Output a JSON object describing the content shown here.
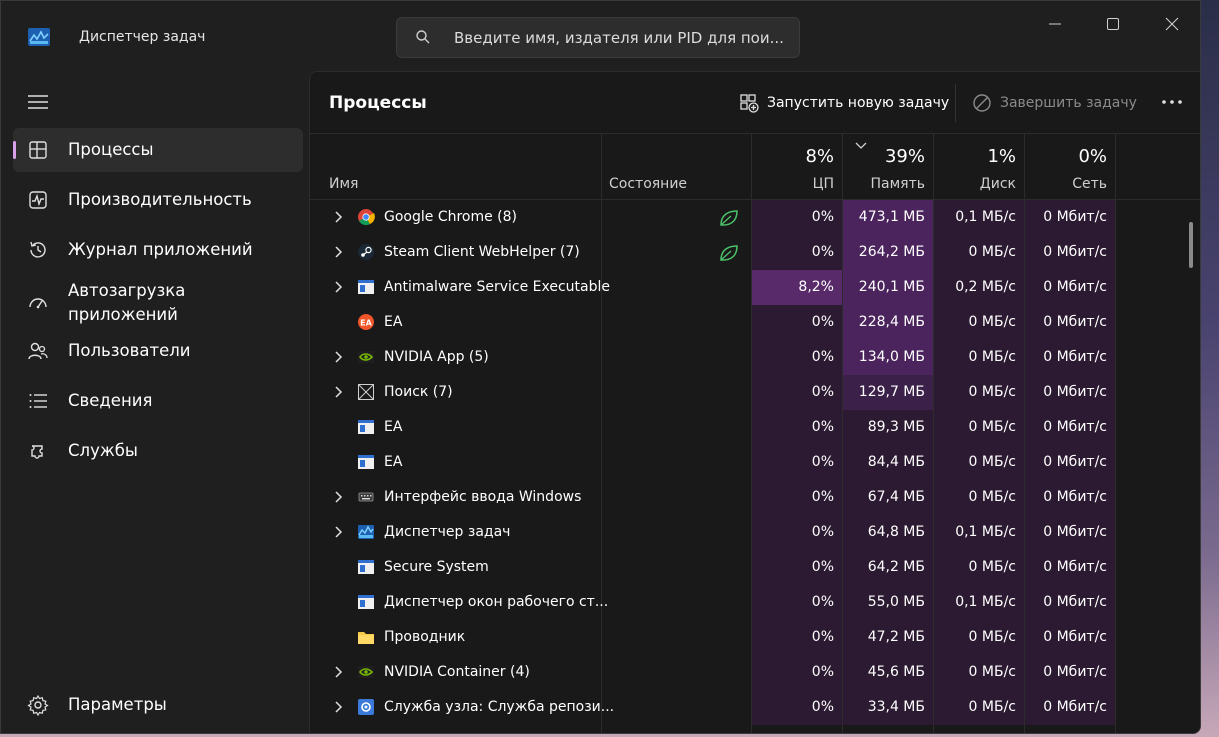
{
  "window": {
    "title": "Диспетчер задач",
    "search_placeholder": "Введите имя, издателя или PID для пои..."
  },
  "sidebar": {
    "items": [
      {
        "label": "Процессы",
        "icon": "processes-icon",
        "active": true
      },
      {
        "label": "Производительность",
        "icon": "performance-icon"
      },
      {
        "label": "Журнал приложений",
        "icon": "app-history-icon"
      },
      {
        "label": "Автозагрузка\nприложений",
        "icon": "startup-apps-icon"
      },
      {
        "label": "Пользователи",
        "icon": "users-icon"
      },
      {
        "label": "Сведения",
        "icon": "details-icon"
      },
      {
        "label": "Службы",
        "icon": "services-icon"
      }
    ],
    "settings_label": "Параметры"
  },
  "toolbar": {
    "page_title": "Процессы",
    "run_task_label": "Запустить новую задачу",
    "end_task_label": "Завершить задачу"
  },
  "columns": {
    "name": "Имя",
    "status": "Состояние",
    "cpu": {
      "pct": "8%",
      "label": "ЦП"
    },
    "memory": {
      "pct": "39%",
      "label": "Память"
    },
    "disk": {
      "pct": "1%",
      "label": "Диск"
    },
    "network": {
      "pct": "0%",
      "label": "Сеть"
    }
  },
  "colors": {
    "heat_1": "#2b1a31",
    "heat_2": "#3b2049",
    "heat_3": "#4c245d",
    "heat_4": "#582a6a",
    "accent": "#d8a1ea"
  },
  "processes": [
    {
      "name": "Google Chrome (8)",
      "icon": "chrome-icon",
      "expandable": true,
      "eco": true,
      "cpu": "0%",
      "memory": "473,1 МБ",
      "disk": "0,1 МБ/с",
      "network": "0 Мбит/с"
    },
    {
      "name": "Steam Client WebHelper (7)",
      "icon": "steam-icon",
      "expandable": true,
      "eco": true,
      "cpu": "0%",
      "memory": "264,2 МБ",
      "disk": "0 МБ/с",
      "network": "0 Мбит/с"
    },
    {
      "name": "Antimalware Service Executable",
      "icon": "window-app-icon",
      "expandable": true,
      "eco": false,
      "cpu": "8,2%",
      "memory": "240,1 МБ",
      "disk": "0,2 МБ/с",
      "network": "0 Мбит/с"
    },
    {
      "name": "EA",
      "icon": "ea-icon",
      "expandable": false,
      "eco": false,
      "cpu": "0%",
      "memory": "228,4 МБ",
      "disk": "0 МБ/с",
      "network": "0 Мбит/с"
    },
    {
      "name": "NVIDIA App (5)",
      "icon": "nvidia-icon",
      "expandable": true,
      "eco": false,
      "cpu": "0%",
      "memory": "134,0 МБ",
      "disk": "0 МБ/с",
      "network": "0 Мбит/с"
    },
    {
      "name": "Поиск (7)",
      "icon": "search-app-icon",
      "expandable": true,
      "eco": false,
      "cpu": "0%",
      "memory": "129,7 МБ",
      "disk": "0 МБ/с",
      "network": "0 Мбит/с"
    },
    {
      "name": "EA",
      "icon": "window-app-icon",
      "expandable": false,
      "eco": false,
      "cpu": "0%",
      "memory": "89,3 МБ",
      "disk": "0 МБ/с",
      "network": "0 Мбит/с"
    },
    {
      "name": "EA",
      "icon": "window-app-icon",
      "expandable": false,
      "eco": false,
      "cpu": "0%",
      "memory": "84,4 МБ",
      "disk": "0 МБ/с",
      "network": "0 Мбит/с"
    },
    {
      "name": "Интерфейс ввода Windows",
      "icon": "keyboard-icon",
      "expandable": true,
      "eco": false,
      "cpu": "0%",
      "memory": "67,4 МБ",
      "disk": "0 МБ/с",
      "network": "0 Мбит/с"
    },
    {
      "name": "Диспетчер задач",
      "icon": "task-manager-icon",
      "expandable": true,
      "eco": false,
      "cpu": "0%",
      "memory": "64,8 МБ",
      "disk": "0,1 МБ/с",
      "network": "0 Мбит/с"
    },
    {
      "name": "Secure System",
      "icon": "window-app-icon",
      "expandable": false,
      "eco": false,
      "cpu": "0%",
      "memory": "64,2 МБ",
      "disk": "0 МБ/с",
      "network": "0 Мбит/с"
    },
    {
      "name": "Диспетчер окон рабочего ст...",
      "icon": "window-app-icon",
      "expandable": false,
      "eco": false,
      "cpu": "0%",
      "memory": "55,0 МБ",
      "disk": "0,1 МБ/с",
      "network": "0 Мбит/с"
    },
    {
      "name": "Проводник",
      "icon": "folder-icon",
      "expandable": false,
      "eco": false,
      "cpu": "0%",
      "memory": "47,2 МБ",
      "disk": "0 МБ/с",
      "network": "0 Мбит/с"
    },
    {
      "name": "NVIDIA Container (4)",
      "icon": "nvidia-icon",
      "expandable": true,
      "eco": false,
      "cpu": "0%",
      "memory": "45,6 МБ",
      "disk": "0 МБ/с",
      "network": "0 Мбит/с"
    },
    {
      "name": "Служба узла: Служба репози...",
      "icon": "gear-app-icon",
      "expandable": true,
      "eco": false,
      "cpu": "0%",
      "memory": "33,4 МБ",
      "disk": "0 МБ/с",
      "network": "0 Мбит/с"
    }
  ]
}
